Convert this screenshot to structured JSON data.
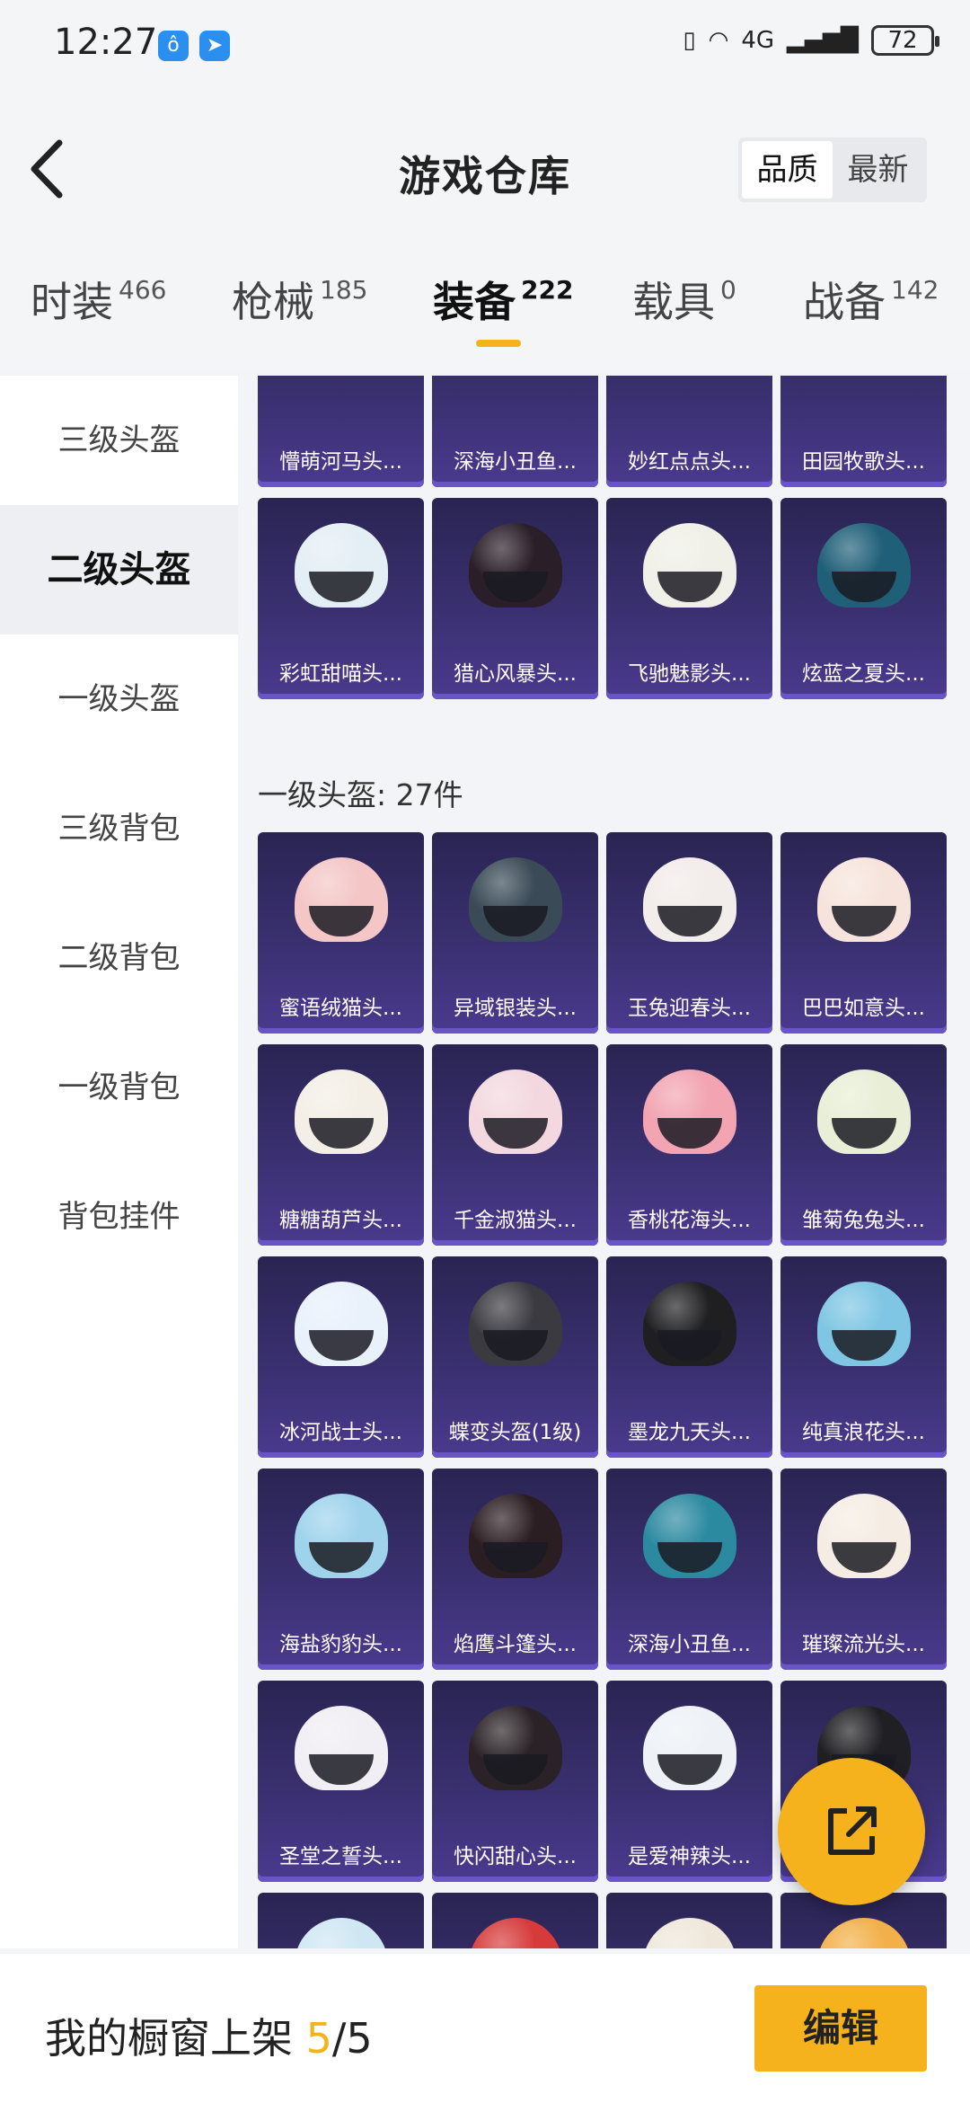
{
  "status": {
    "time": "12:27",
    "network": "4G",
    "battery": "72"
  },
  "header": {
    "title": "游戏仓库",
    "sort": {
      "quality": "品质",
      "newest": "最新"
    }
  },
  "categories": [
    {
      "label": "时装",
      "count": "466"
    },
    {
      "label": "枪械",
      "count": "185"
    },
    {
      "label": "装备",
      "count": "222"
    },
    {
      "label": "载具",
      "count": "0"
    },
    {
      "label": "战备",
      "count": "142"
    }
  ],
  "sidebar": {
    "items": [
      "三级头盔",
      "二级头盔",
      "一级头盔",
      "三级背包",
      "二级背包",
      "一级背包",
      "背包挂件"
    ],
    "active": "二级头盔"
  },
  "sections": [
    {
      "title": "",
      "items": [
        {
          "name": "懵萌河马头...",
          "color": "#cde9f6"
        },
        {
          "name": "深海小丑鱼...",
          "color": "#2c8aa0"
        },
        {
          "name": "妙红点点头...",
          "color": "#d63a3a"
        },
        {
          "name": "田园牧歌头...",
          "color": "#e6ddb0"
        },
        {
          "name": "彩虹甜喵头...",
          "color": "#e4eef5"
        },
        {
          "name": "猎心风暴头...",
          "color": "#2a1e28"
        },
        {
          "name": "飞驰魅影头...",
          "color": "#f0f0e8"
        },
        {
          "name": "炫蓝之夏头...",
          "color": "#1f5f78"
        }
      ]
    },
    {
      "title": "一级头盔: 27件",
      "items": [
        {
          "name": "蜜语绒猫头...",
          "color": "#f4c6c6"
        },
        {
          "name": "异域银装头...",
          "color": "#3a4a56"
        },
        {
          "name": "玉兔迎春头...",
          "color": "#f2ecea"
        },
        {
          "name": "巴巴如意头...",
          "color": "#f6e4dc"
        },
        {
          "name": "糖糖葫芦头...",
          "color": "#f3efe6"
        },
        {
          "name": "千金淑猫头...",
          "color": "#f3d8e0"
        },
        {
          "name": "香桃花海头...",
          "color": "#f2a4b2"
        },
        {
          "name": "雏菊兔兔头...",
          "color": "#e8efd6"
        },
        {
          "name": "冰河战士头...",
          "color": "#e9f1fb"
        },
        {
          "name": "蝶变头盔(1级)",
          "color": "#3a3a40"
        },
        {
          "name": "墨龙九天头...",
          "color": "#1f1f22"
        },
        {
          "name": "纯真浪花头...",
          "color": "#7ec6e3"
        },
        {
          "name": "海盐豹豹头...",
          "color": "#9fd3ec"
        },
        {
          "name": "焰鹰斗篷头...",
          "color": "#2b1e22"
        },
        {
          "name": "深海小丑鱼...",
          "color": "#2c8aa0"
        },
        {
          "name": "璀璨流光头...",
          "color": "#f5ede4"
        },
        {
          "name": "圣堂之誓头...",
          "color": "#f1eef4"
        },
        {
          "name": "快闪甜心头...",
          "color": "#2a2226"
        },
        {
          "name": "是爱神辣头...",
          "color": "#eef2f6"
        },
        {
          "name": "",
          "color": "#202024"
        },
        {
          "name": "",
          "color": "#cfe7f3"
        },
        {
          "name": "",
          "color": "#d63a3a"
        },
        {
          "name": "",
          "color": "#efe8da"
        },
        {
          "name": "",
          "color": "#f2b04a"
        }
      ]
    }
  ],
  "bottom": {
    "label": "我的橱窗上架",
    "count": "5",
    "total": "/5",
    "edit": "编辑"
  },
  "colors": {
    "accent": "#f6b21c",
    "card_bg": "#3a3070"
  }
}
